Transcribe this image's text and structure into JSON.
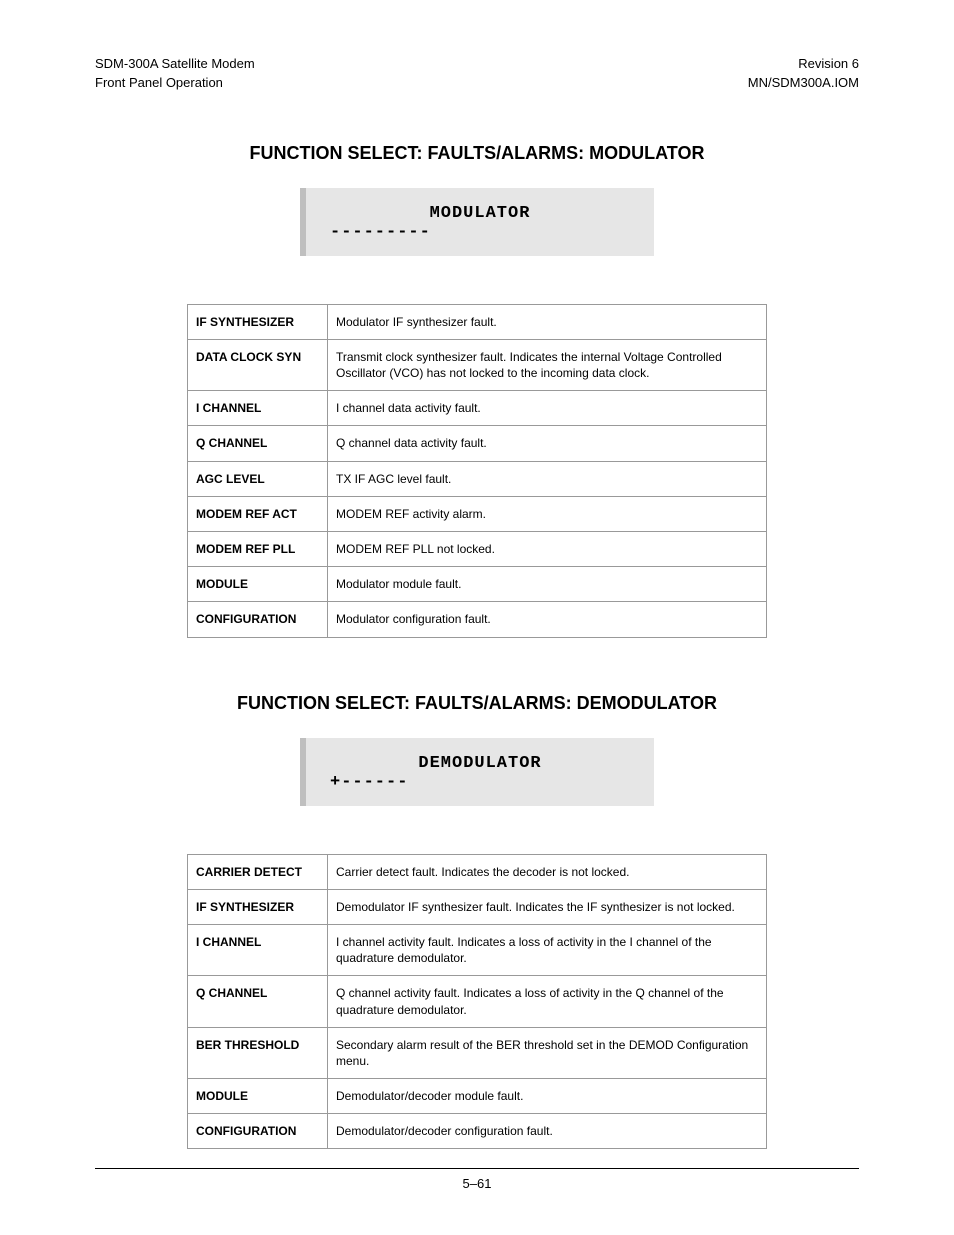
{
  "header": {
    "left_line1": "SDM-300A Satellite Modem",
    "left_line2": "Front Panel Operation",
    "right_line1": "Revision 6",
    "right_line2": "MN/SDM300A.IOM"
  },
  "section1": {
    "title": "FUNCTION SELECT: FAULTS/ALARMS: MODULATOR",
    "lcd_line1": "MODULATOR",
    "lcd_line2": "---------",
    "rows": [
      {
        "name": "IF SYNTHESIZER",
        "desc": "Modulator IF synthesizer fault."
      },
      {
        "name": "DATA CLOCK SYN",
        "desc": "Transmit clock synthesizer fault. Indicates the internal Voltage Controlled Oscillator (VCO) has not locked to the incoming data clock."
      },
      {
        "name": "I CHANNEL",
        "desc": "I channel data activity fault."
      },
      {
        "name": "Q CHANNEL",
        "desc": "Q channel data activity fault."
      },
      {
        "name": "AGC LEVEL",
        "desc": "TX IF AGC level fault."
      },
      {
        "name": "MODEM REF ACT",
        "desc": "MODEM REF activity alarm."
      },
      {
        "name": "MODEM REF PLL",
        "desc": "MODEM REF PLL not locked."
      },
      {
        "name": "MODULE",
        "desc": "Modulator module fault."
      },
      {
        "name": "CONFIGURATION",
        "desc": "Modulator configuration fault."
      }
    ]
  },
  "section2": {
    "title": "FUNCTION SELECT: FAULTS/ALARMS: DEMODULATOR",
    "lcd_line1": "DEMODULATOR",
    "lcd_line2": "+------",
    "rows": [
      {
        "name": "CARRIER DETECT",
        "desc": "Carrier detect fault. Indicates the decoder is not locked."
      },
      {
        "name": "IF SYNTHESIZER",
        "desc": "Demodulator IF synthesizer fault. Indicates the IF synthesizer is not locked."
      },
      {
        "name": "I CHANNEL",
        "desc": "I channel activity fault. Indicates a loss of activity in the I channel of the quadrature demodulator."
      },
      {
        "name": "Q CHANNEL",
        "desc": "Q channel activity fault. Indicates a loss of activity in the Q channel of the quadrature demodulator."
      },
      {
        "name": "BER THRESHOLD",
        "desc": "Secondary alarm result of the BER threshold set in the DEMOD Configuration menu."
      },
      {
        "name": "MODULE",
        "desc": "Demodulator/decoder module fault."
      },
      {
        "name": "CONFIGURATION",
        "desc": "Demodulator/decoder configuration fault."
      }
    ]
  },
  "footer": {
    "page": "5–61"
  }
}
